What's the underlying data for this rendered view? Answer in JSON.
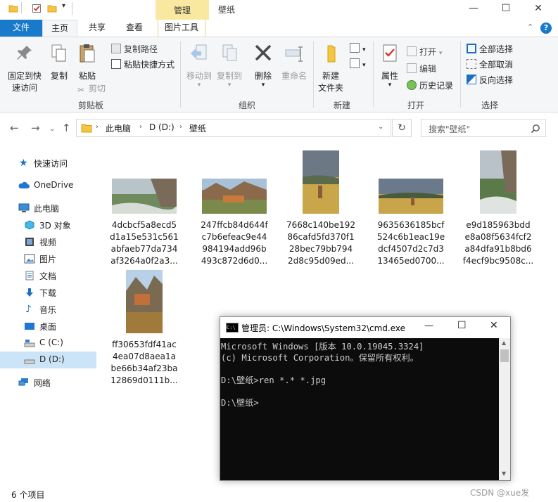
{
  "window": {
    "title": "壁纸",
    "contextual_tab": "管理",
    "controls": {
      "minimize": "—",
      "maximize": "☐",
      "close": "✕"
    }
  },
  "ribbon": {
    "tabs": [
      "文件",
      "主页",
      "共享",
      "查看",
      "图片工具"
    ],
    "groups": {
      "clipboard": {
        "label": "剪贴板",
        "pin": "固定到快\n速访问",
        "pin_line1": "固定到快",
        "pin_line2": "速访问",
        "copy": "复制",
        "paste": "粘贴",
        "copy_path": "复制路径",
        "paste_shortcut": "粘贴快捷方式",
        "cut": "剪切"
      },
      "organize": {
        "label": "组织",
        "move_to": "移动到",
        "copy_to": "复制到",
        "delete": "删除",
        "rename": "重命名"
      },
      "new": {
        "label": "新建",
        "new_folder_line1": "新建",
        "new_folder_line2": "文件夹"
      },
      "open": {
        "label": "打开",
        "properties": "属性",
        "open": "打开",
        "edit": "编辑",
        "history": "历史记录"
      },
      "select": {
        "label": "选择",
        "select_all": "全部选择",
        "select_none": "全部取消",
        "invert": "反向选择"
      }
    }
  },
  "address": {
    "path": [
      "此电脑",
      "D (D:)",
      "壁纸"
    ],
    "search_placeholder": "搜索\"壁纸\""
  },
  "nav": {
    "items": [
      {
        "label": "快速访问",
        "icon": "star-icon"
      },
      {
        "label": "OneDrive",
        "icon": "cloud-icon"
      },
      {
        "label": "此电脑",
        "icon": "computer-icon"
      },
      {
        "label": "3D 对象",
        "icon": "cube-icon"
      },
      {
        "label": "视频",
        "icon": "video-icon"
      },
      {
        "label": "图片",
        "icon": "picture-icon"
      },
      {
        "label": "文档",
        "icon": "document-icon"
      },
      {
        "label": "下载",
        "icon": "download-icon"
      },
      {
        "label": "音乐",
        "icon": "music-icon"
      },
      {
        "label": "桌面",
        "icon": "desktop-icon"
      },
      {
        "label": "C (C:)",
        "icon": "drive-icon"
      },
      {
        "label": "D (D:)",
        "icon": "drive-icon"
      },
      {
        "label": "网络",
        "icon": "network-icon"
      }
    ],
    "selected": "D (D:)"
  },
  "files": [
    {
      "name_lines": [
        "4dcbcf5a8ecd5",
        "d1a15e531c561",
        "abfaeb77da734",
        "af3264a0f2a3..."
      ]
    },
    {
      "name_lines": [
        "247ffcb84d644f",
        "c7b6efeac9e44",
        "984194add96b",
        "493c872d6d0..."
      ]
    },
    {
      "name_lines": [
        "7668c140be192",
        "86cafd5fd370f1",
        "28bec79bb794",
        "2d8c95d09ed..."
      ]
    },
    {
      "name_lines": [
        "9635636185bcf",
        "524c6b1eac19e",
        "dcf4507d2c7d3",
        "13465ed0700..."
      ]
    },
    {
      "name_lines": [
        "e9d185963bdd",
        "e8a08f5634fcf2",
        "a84dfa91b8bd6",
        "f4ecf9bc9508c..."
      ]
    },
    {
      "name_lines": [
        "ff30653fdf41ac",
        "4ea07d8aea1a",
        "be66b34af23ba",
        "12869d0111b..."
      ]
    }
  ],
  "status": {
    "item_count": "6 个项目"
  },
  "cmd": {
    "title": "管理员: C:\\Windows\\System32\\cmd.exe",
    "lines": [
      "Microsoft Windows [版本 10.0.19045.3324]",
      "(c) Microsoft Corporation。保留所有权利。",
      "",
      "D:\\壁纸>ren *.* *.jpg",
      "",
      "D:\\壁纸>"
    ]
  },
  "watermark": "CSDN @xue发"
}
